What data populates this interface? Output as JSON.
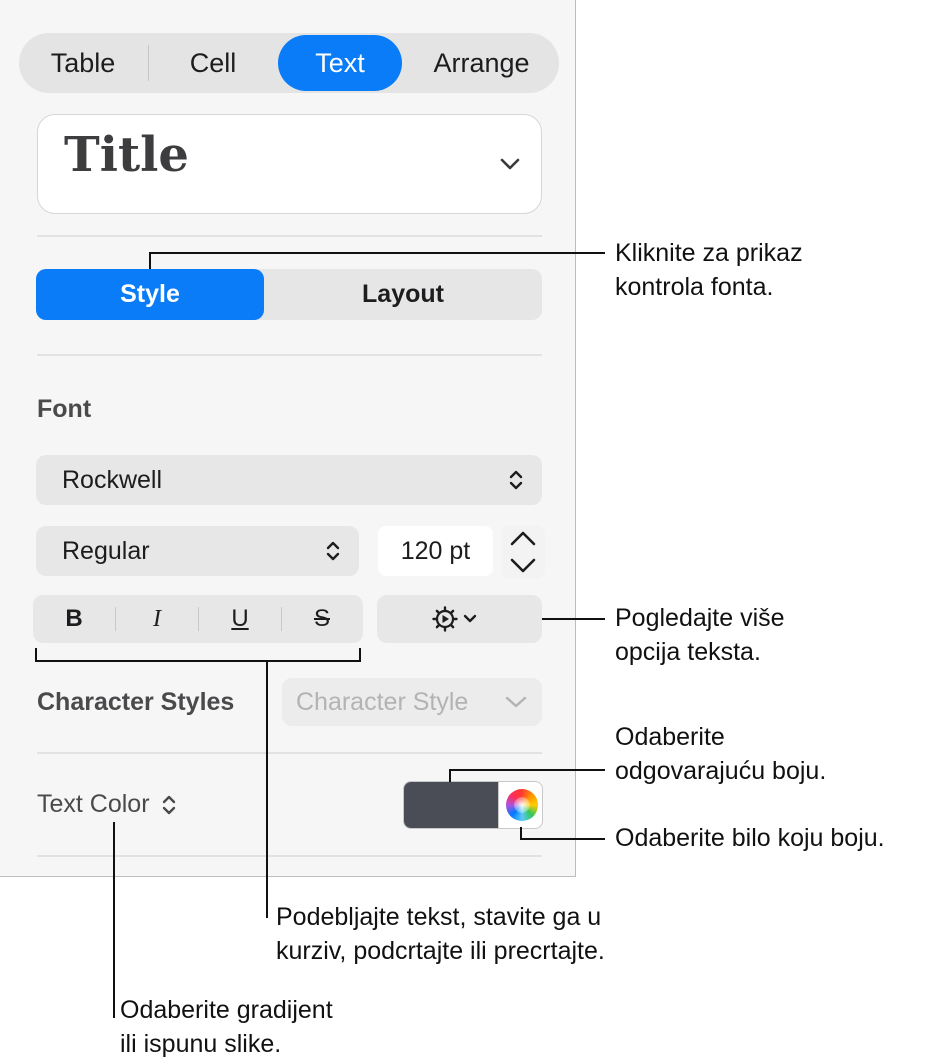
{
  "tabs": [
    "Table",
    "Cell",
    "Text",
    "Arrange"
  ],
  "active_tab": "Text",
  "paragraph_style": "Title",
  "style_layout": [
    "Style",
    "Layout"
  ],
  "font": {
    "section_label": "Font",
    "family": "Rockwell",
    "typeface": "Regular",
    "size": "120 pt",
    "format_buttons": [
      "B",
      "I",
      "U",
      "S"
    ]
  },
  "character_styles": {
    "label": "Character Styles",
    "placeholder": "Character Style"
  },
  "text_color": {
    "label": "Text Color",
    "swatch_color": "#4a4d55"
  },
  "callouts": {
    "style_tab": [
      "Kliknite za prikaz",
      "kontrola fonta."
    ],
    "more_options": [
      "Pogledajte više",
      "opcija teksta."
    ],
    "matching_color": [
      "Odaberite",
      "odgovarajuću boju."
    ],
    "any_color": "Odaberite bilo koju boju.",
    "format_buttons": [
      "Podebljajte tekst, stavite ga u",
      "kurziv, podcrtajte ili precrtajte."
    ],
    "text_color": [
      "Odaberite gradijent",
      "ili ispunu slike."
    ]
  },
  "accent_color": "#0a7cf7"
}
